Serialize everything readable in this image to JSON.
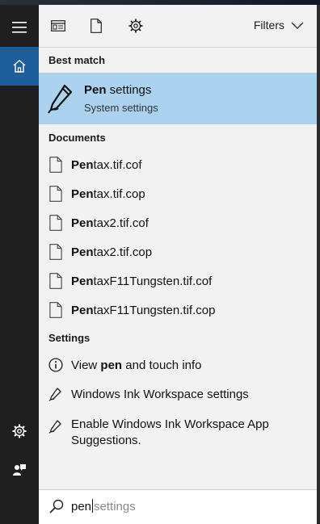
{
  "colors": {
    "accent": "#1f5f99",
    "best_match_highlight": "#abd2ef",
    "panel_bg": "#f2f2f2",
    "rail_bg": "#1f1f1f"
  },
  "rail": {
    "items": [
      {
        "icon": "hamburger-menu-icon"
      },
      {
        "icon": "home-icon",
        "active": true
      },
      {
        "icon": "gear-icon"
      },
      {
        "icon": "user-feedback-icon"
      }
    ]
  },
  "toolbar": {
    "icons": [
      "apps-icon",
      "document-icon",
      "gear-icon"
    ],
    "filters_label": "Filters"
  },
  "best_match": {
    "section_label": "Best match",
    "title_bold": "Pen",
    "title_rest": " settings",
    "subtitle": "System settings",
    "icon": "pen-icon"
  },
  "documents": {
    "section_label": "Documents",
    "items": [
      {
        "bold": "Pen",
        "rest": "tax.tif.cof"
      },
      {
        "bold": "Pen",
        "rest": "tax.tif.cop"
      },
      {
        "bold": "Pen",
        "rest": "tax2.tif.cof"
      },
      {
        "bold": "Pen",
        "rest": "tax2.tif.cop"
      },
      {
        "bold": "Pen",
        "rest": "taxF11Tungsten.tif.cof"
      },
      {
        "bold": "Pen",
        "rest": "taxF11Tungsten.tif.cop"
      }
    ]
  },
  "settings": {
    "section_label": "Settings",
    "items": [
      {
        "icon": "info-icon",
        "pre": "View ",
        "bold": "pen",
        "post": " and touch info"
      },
      {
        "icon": "pen-icon",
        "pre": "Windows Ink Workspace settings",
        "bold": "",
        "post": ""
      },
      {
        "icon": "pen-icon",
        "pre": "Enable Windows Ink Workspace App Suggestions.",
        "bold": "",
        "post": ""
      }
    ]
  },
  "search": {
    "typed": "pen",
    "suggestion": "settings",
    "icon": "search-icon"
  }
}
